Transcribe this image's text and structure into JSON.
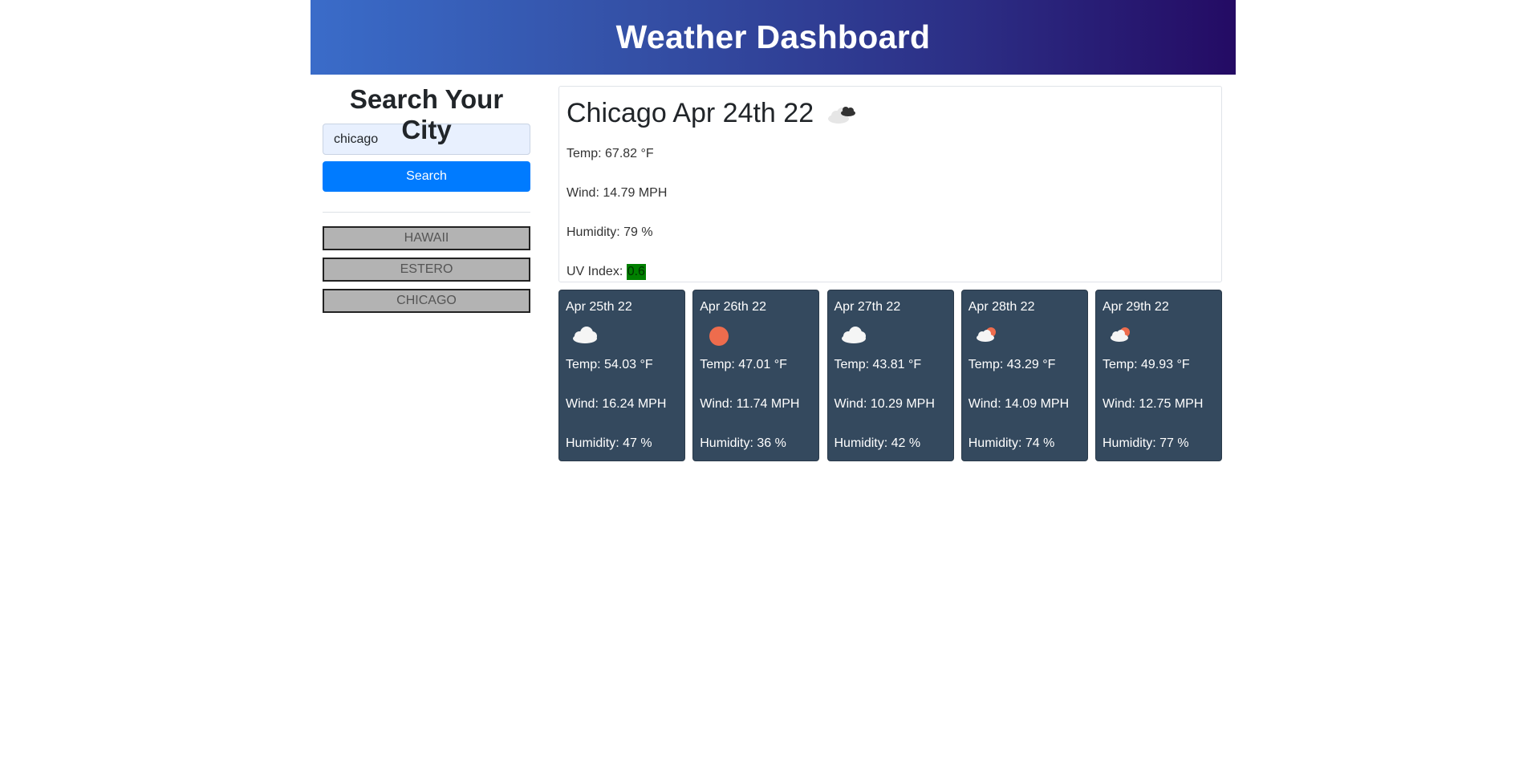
{
  "header": {
    "title": "Weather Dashboard"
  },
  "sidebar": {
    "heading": "Search Your City",
    "search_value": "chicago",
    "search_button": "Search",
    "history": [
      "HAWAII",
      "ESTERO",
      "CHICAGO"
    ]
  },
  "current": {
    "title": "Chicago Apr 24th 22",
    "icon": "broken-clouds-icon",
    "temp": "Temp: 67.82 °F",
    "wind": "Wind: 14.79 MPH",
    "humidity": "Humidity: 79 %",
    "uv_label": "UV Index: ",
    "uv_value": "0.6",
    "uv_color": "#008000"
  },
  "forecast": [
    {
      "date": "Apr 25th 22",
      "icon": "cloud-icon",
      "temp": "Temp: 54.03 °F",
      "wind": "Wind: 16.24 MPH",
      "humidity": "Humidity: 47 %"
    },
    {
      "date": "Apr 26th 22",
      "icon": "sun-icon",
      "temp": "Temp: 47.01 °F",
      "wind": "Wind: 11.74 MPH",
      "humidity": "Humidity: 36 %"
    },
    {
      "date": "Apr 27th 22",
      "icon": "cloud-icon",
      "temp": "Temp: 43.81 °F",
      "wind": "Wind: 10.29 MPH",
      "humidity": "Humidity: 42 %"
    },
    {
      "date": "Apr 28th 22",
      "icon": "partly-cloudy-icon",
      "temp": "Temp: 43.29 °F",
      "wind": "Wind: 14.09 MPH",
      "humidity": "Humidity: 74 %"
    },
    {
      "date": "Apr 29th 22",
      "icon": "partly-cloudy-icon",
      "temp": "Temp: 49.93 °F",
      "wind": "Wind: 12.75 MPH",
      "humidity": "Humidity: 77 %"
    }
  ],
  "colors": {
    "forecast_card_bg": "#34495e",
    "search_button_bg": "#007bff",
    "history_button_bg": "#b3b3b3"
  }
}
